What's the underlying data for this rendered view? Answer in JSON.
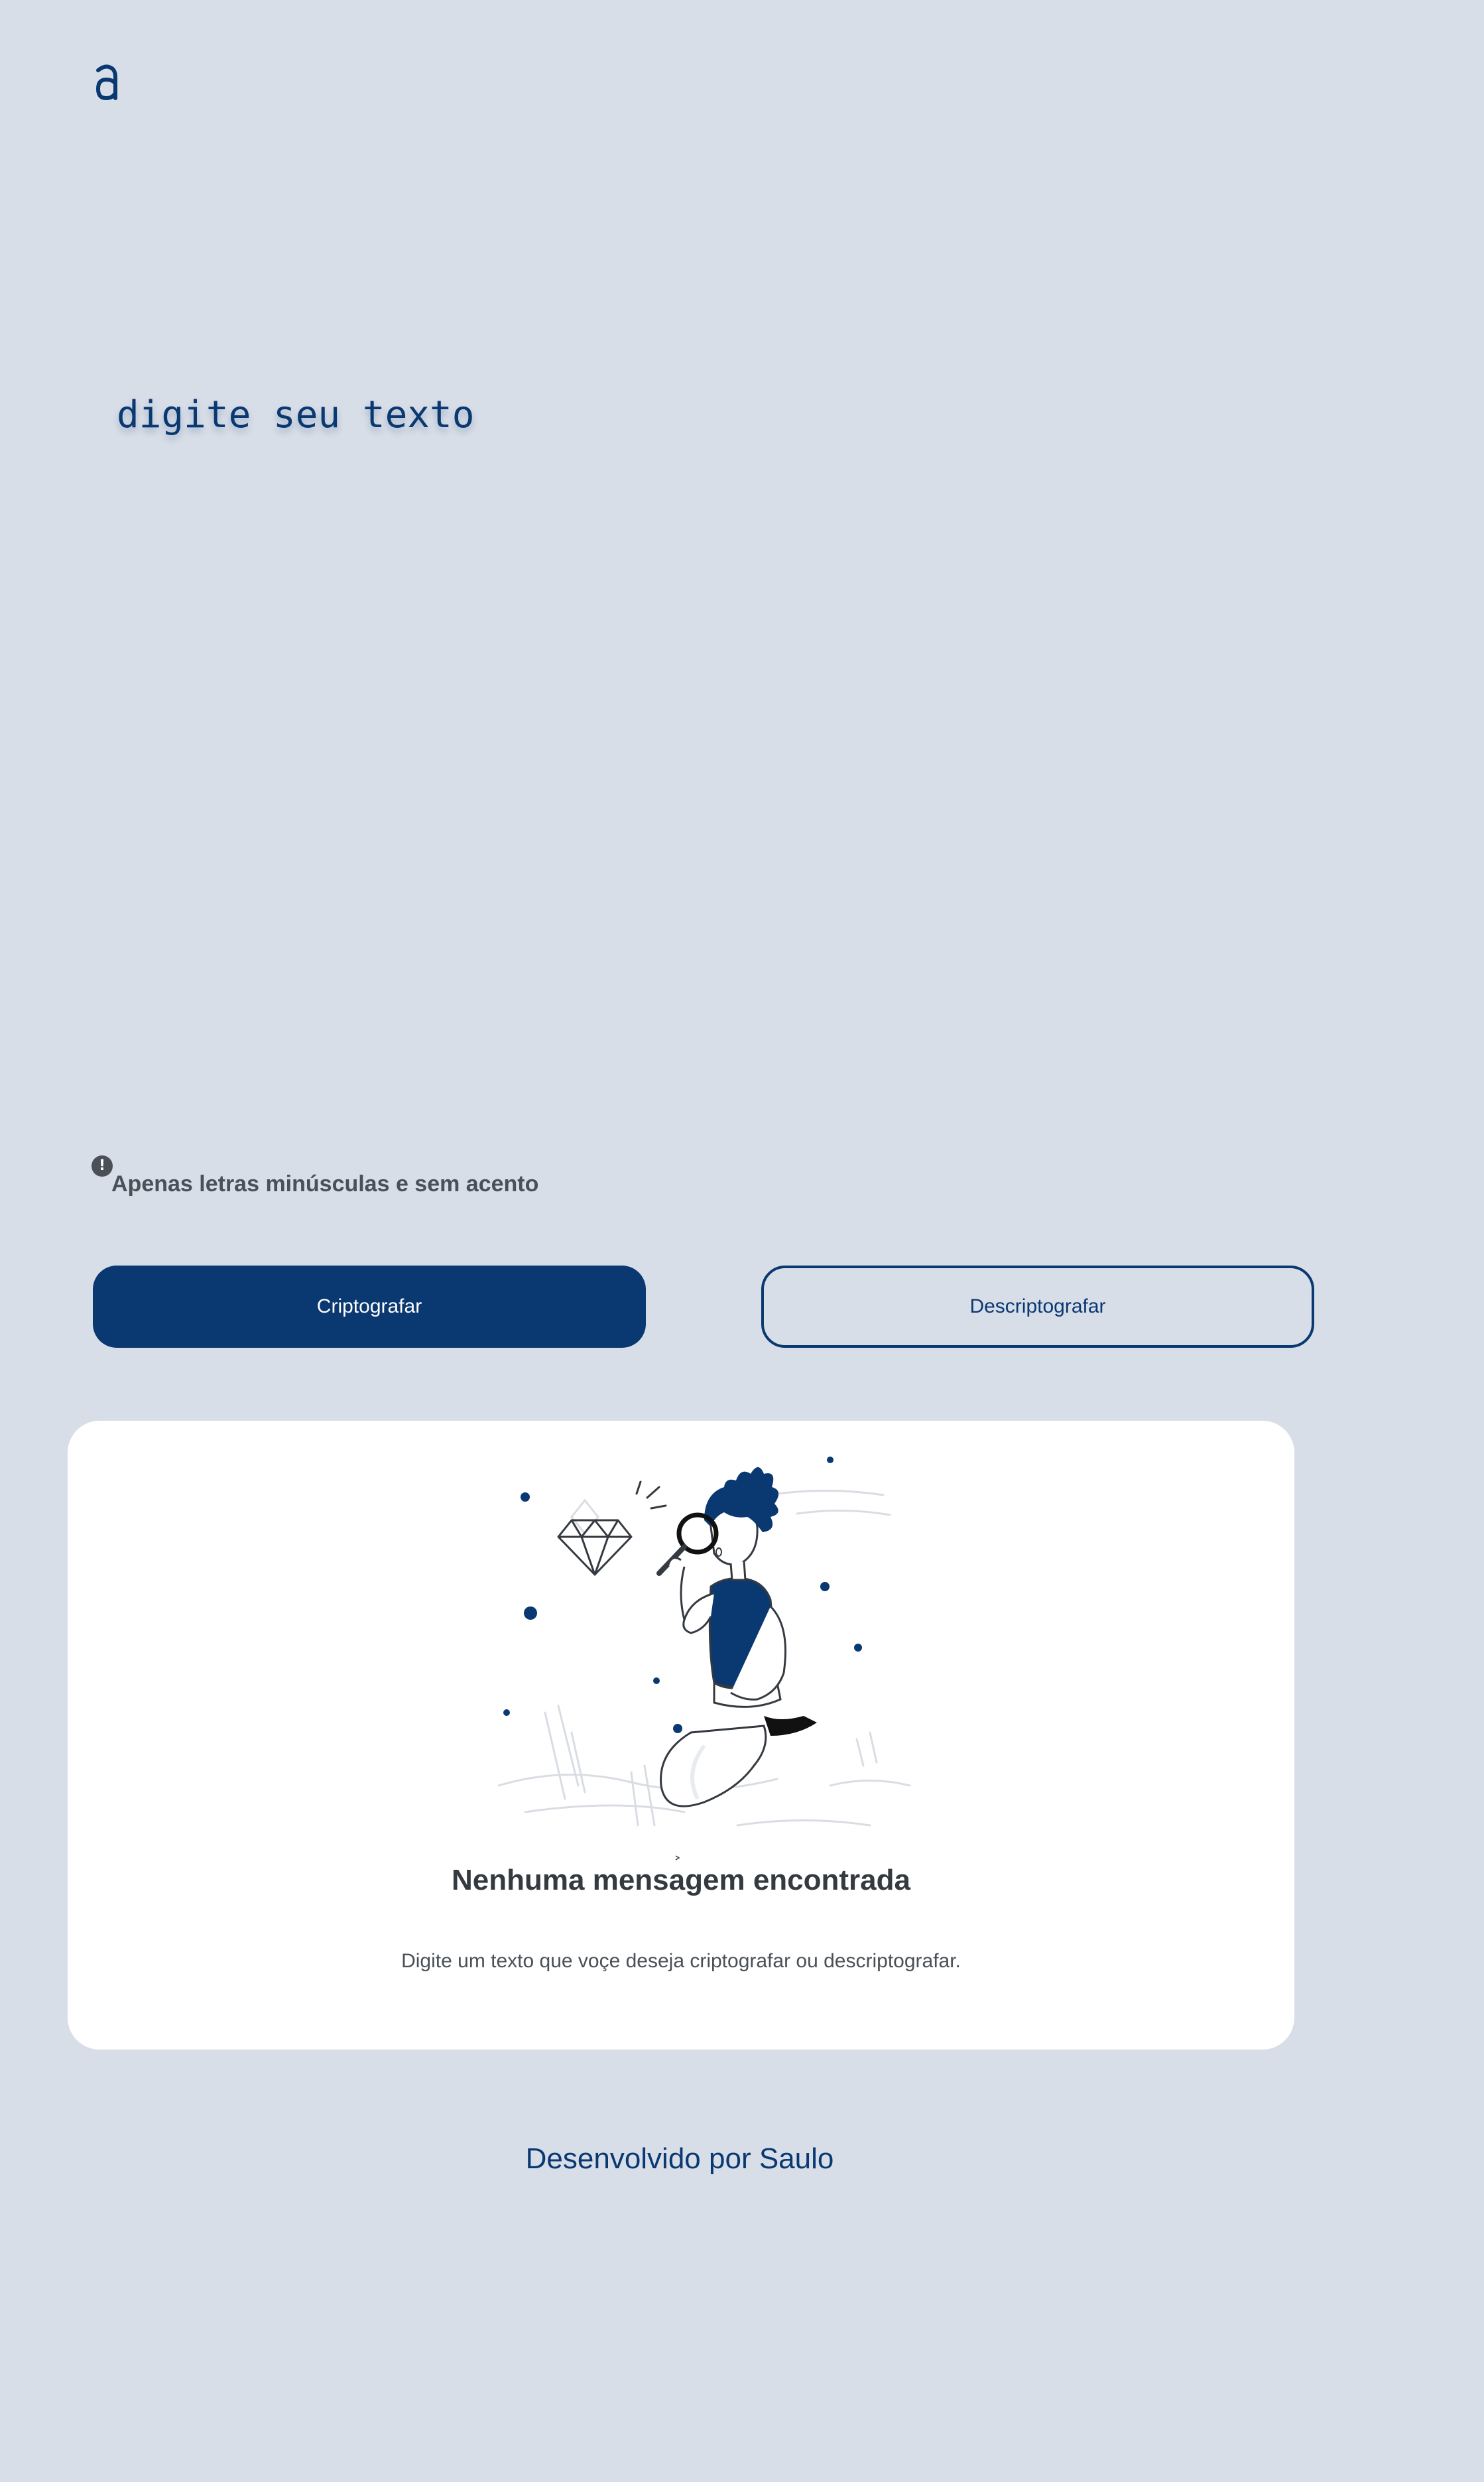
{
  "brand": {
    "logo_icon": "alura-logo-icon",
    "color": "#0a3871"
  },
  "input": {
    "placeholder": "digite seu texto",
    "value": ""
  },
  "hint": {
    "icon": "info-icon",
    "text": "Apenas letras minúsculas e sem acento"
  },
  "buttons": {
    "encrypt_label": "Criptografar",
    "decrypt_label": "Descriptografar"
  },
  "output": {
    "illustration": "person-with-magnifying-glass-illustration",
    "empty_title": "Nenhuma mensagem encontrada",
    "empty_description": "Digite um texto que voçe deseja criptografar ou descriptografar."
  },
  "footer": {
    "text": "Desenvolvido por Saulo"
  },
  "colors": {
    "background": "#d8dee8",
    "primary": "#0a3871",
    "card": "#ffffff",
    "muted_text": "#495057"
  }
}
